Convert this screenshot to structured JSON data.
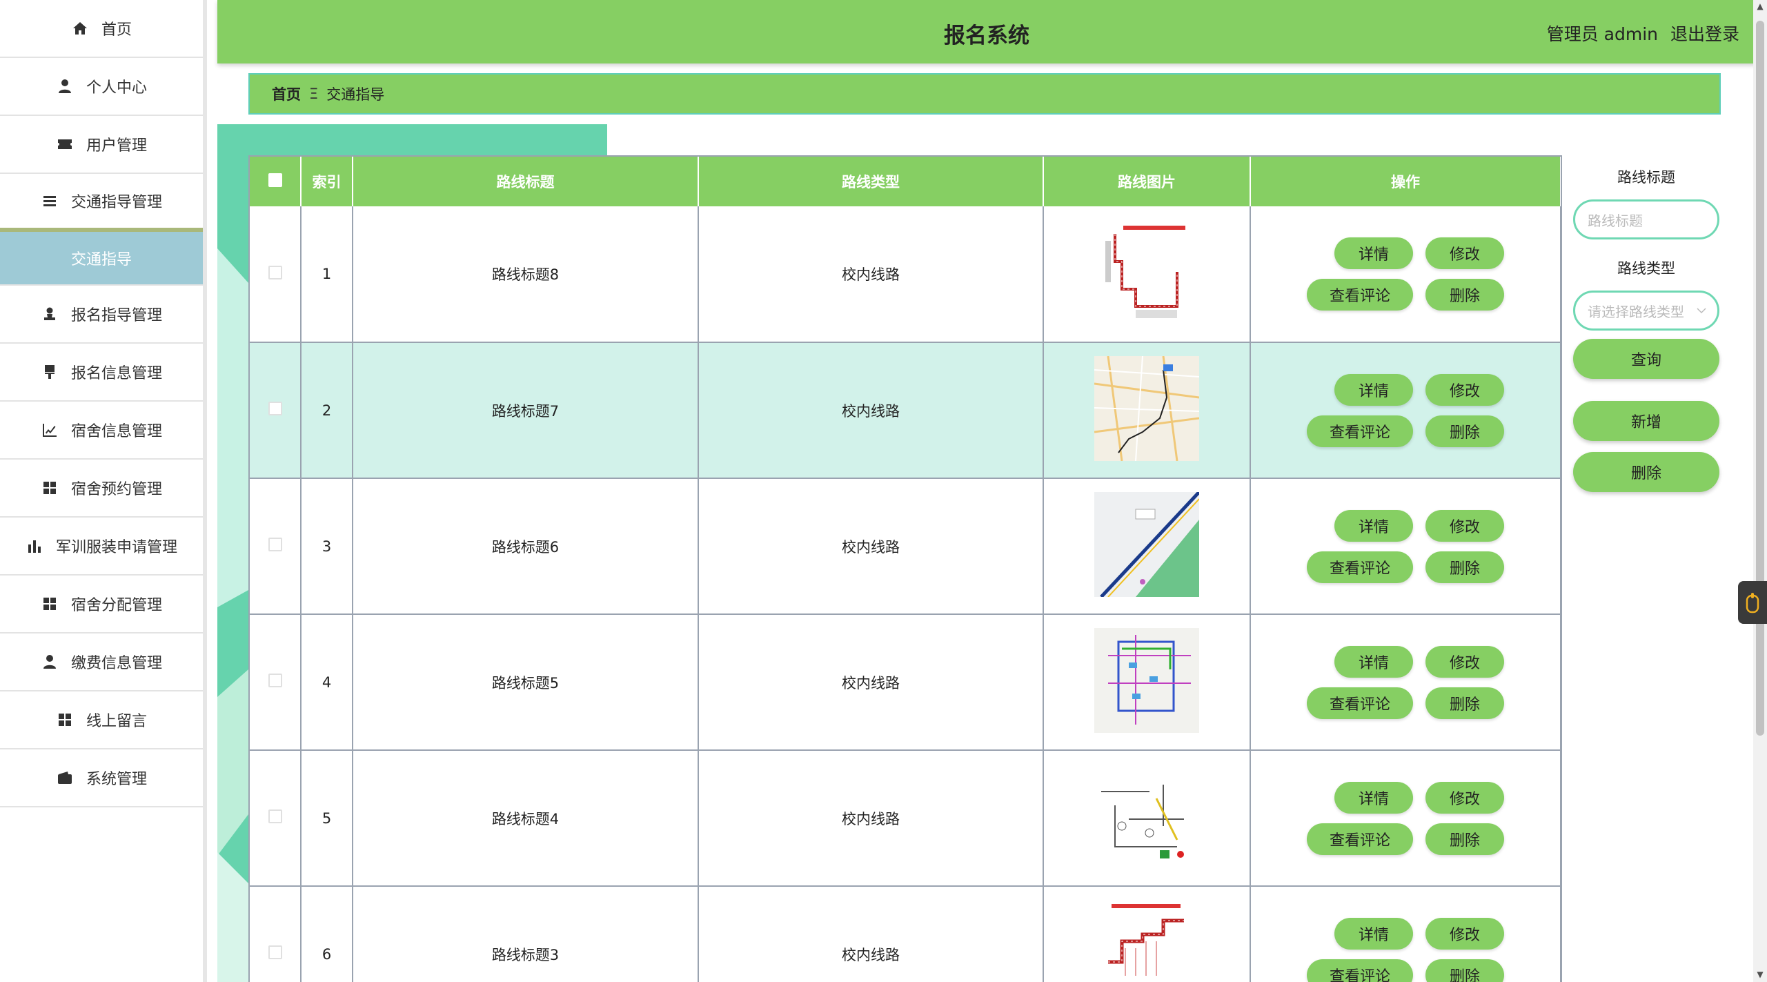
{
  "header": {
    "title": "报名系统",
    "user": "管理员 admin",
    "logout": "退出登录"
  },
  "sidebar": {
    "items": [
      {
        "label": "首页",
        "icon": "home-icon"
      },
      {
        "label": "个人中心",
        "icon": "user-icon"
      },
      {
        "label": "用户管理",
        "icon": "ticket-icon"
      },
      {
        "label": "交通指导管理",
        "icon": "list-icon"
      },
      {
        "label": "交通指导",
        "icon": ""
      },
      {
        "label": "报名指导管理",
        "icon": "person-icon"
      },
      {
        "label": "报名信息管理",
        "icon": "brush-icon"
      },
      {
        "label": "宿舍信息管理",
        "icon": "trend-chart-icon"
      },
      {
        "label": "宿舍预约管理",
        "icon": "grid-icon"
      },
      {
        "label": "军训服装申请管理",
        "icon": "bar-chart-icon"
      },
      {
        "label": "宿舍分配管理",
        "icon": "grid-icon"
      },
      {
        "label": "缴费信息管理",
        "icon": "user-icon"
      },
      {
        "label": "线上留言",
        "icon": "grid-icon"
      },
      {
        "label": "系统管理",
        "icon": "wallet-icon"
      }
    ]
  },
  "breadcrumb": {
    "home": "首页",
    "separator": "Ξ",
    "current": "交通指导"
  },
  "table": {
    "columns": [
      "索引",
      "路线标题",
      "路线类型",
      "路线图片",
      "操作"
    ],
    "rows": [
      {
        "index": "1",
        "title": "路线标题8",
        "type": "校内线路"
      },
      {
        "index": "2",
        "title": "路线标题7",
        "type": "校内线路"
      },
      {
        "index": "3",
        "title": "路线标题6",
        "type": "校内线路"
      },
      {
        "index": "4",
        "title": "路线标题5",
        "type": "校内线路"
      },
      {
        "index": "5",
        "title": "路线标题4",
        "type": "校内线路"
      },
      {
        "index": "6",
        "title": "路线标题3",
        "type": "校内线路"
      }
    ],
    "ops": {
      "detail": "详情",
      "edit": "修改",
      "comments": "查看评论",
      "delete": "删除"
    }
  },
  "search": {
    "title_label": "路线标题",
    "title_placeholder": "路线标题",
    "type_label": "路线类型",
    "type_placeholder": "请选择路线类型",
    "query": "查询",
    "add": "新增",
    "delete": "删除"
  },
  "colors": {
    "primary": "#86cf63",
    "accent": "#66d3ad",
    "active_nav": "#9ecad6",
    "row_highlight": "#d2f2ea"
  }
}
